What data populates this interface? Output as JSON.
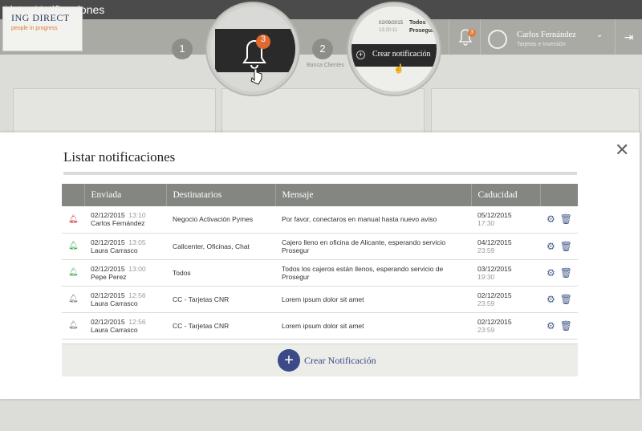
{
  "window": {
    "title": "Listar Notificaciones"
  },
  "header": {
    "logo_brand": "ING DIRECT",
    "logo_tag": "people in progress",
    "steps": [
      "1",
      "2"
    ],
    "step_label": "Banca Clientes",
    "bell_badge": "3",
    "user_name": "Carlos Fernández",
    "user_role": "Tarjetas e Inversión",
    "zoom_bell_badge": "3",
    "zoom_preview_date": "02/09/2015",
    "zoom_preview_time": "13:20:11",
    "zoom_preview_dest": "Todos",
    "zoom_preview_msg": "Prosegur",
    "zoom_create_label": "Crear notificación"
  },
  "modal": {
    "title": "Listar notificaciones",
    "columns": [
      "",
      "Enviada",
      "Destinatarios",
      "Mensaje",
      "Caducidad",
      ""
    ],
    "rows": [
      {
        "status_color": "#c9312e",
        "date": "02/12/2015",
        "time": "13:10",
        "author": "Carlos Fernández",
        "recipients": "Negocio Activación Pymes",
        "message": "Por favor, conectaros en manual hasta nuevo aviso",
        "exp_date": "05/12/2015",
        "exp_time": "17:30"
      },
      {
        "status_color": "#3aa64a",
        "date": "02/12/2015",
        "time": "13:05",
        "author": "Laura Carrasco",
        "recipients": "Callcenter, Oficinas, Chat",
        "message": "Cajero lleno en oficina de Alicante, esperando servicio Prosegur",
        "exp_date": "04/12/2015",
        "exp_time": "23:59"
      },
      {
        "status_color": "#3aa64a",
        "date": "02/12/2015",
        "time": "13:00",
        "author": "Pepe Perez",
        "recipients": "Todos",
        "message": "Todos los cajeros están llenos, esperando servicio de Prosegur",
        "exp_date": "03/12/2015",
        "exp_time": "19:30"
      },
      {
        "status_color": "#7d7d7d",
        "date": "02/12/2015",
        "time": "12:56",
        "author": "Laura Carrasco",
        "recipients": "CC - Tarjetas CNR",
        "message": "Lorem ipsum dolor sit amet",
        "exp_date": "02/12/2015",
        "exp_time": "23:59"
      },
      {
        "status_color": "#7d7d7d",
        "date": "02/12/2015",
        "time": "12:56",
        "author": "Laura Carrasco",
        "recipients": "CC - Tarjetas CNR",
        "message": "Lorem ipsum dolor sit amet",
        "exp_date": "02/12/2015",
        "exp_time": "23:59"
      }
    ],
    "create_label": "Crear Notificación",
    "icons": {
      "close": "close-icon",
      "settings": "gear-icon",
      "delete": "trash-icon",
      "status": "bell-icon"
    }
  }
}
